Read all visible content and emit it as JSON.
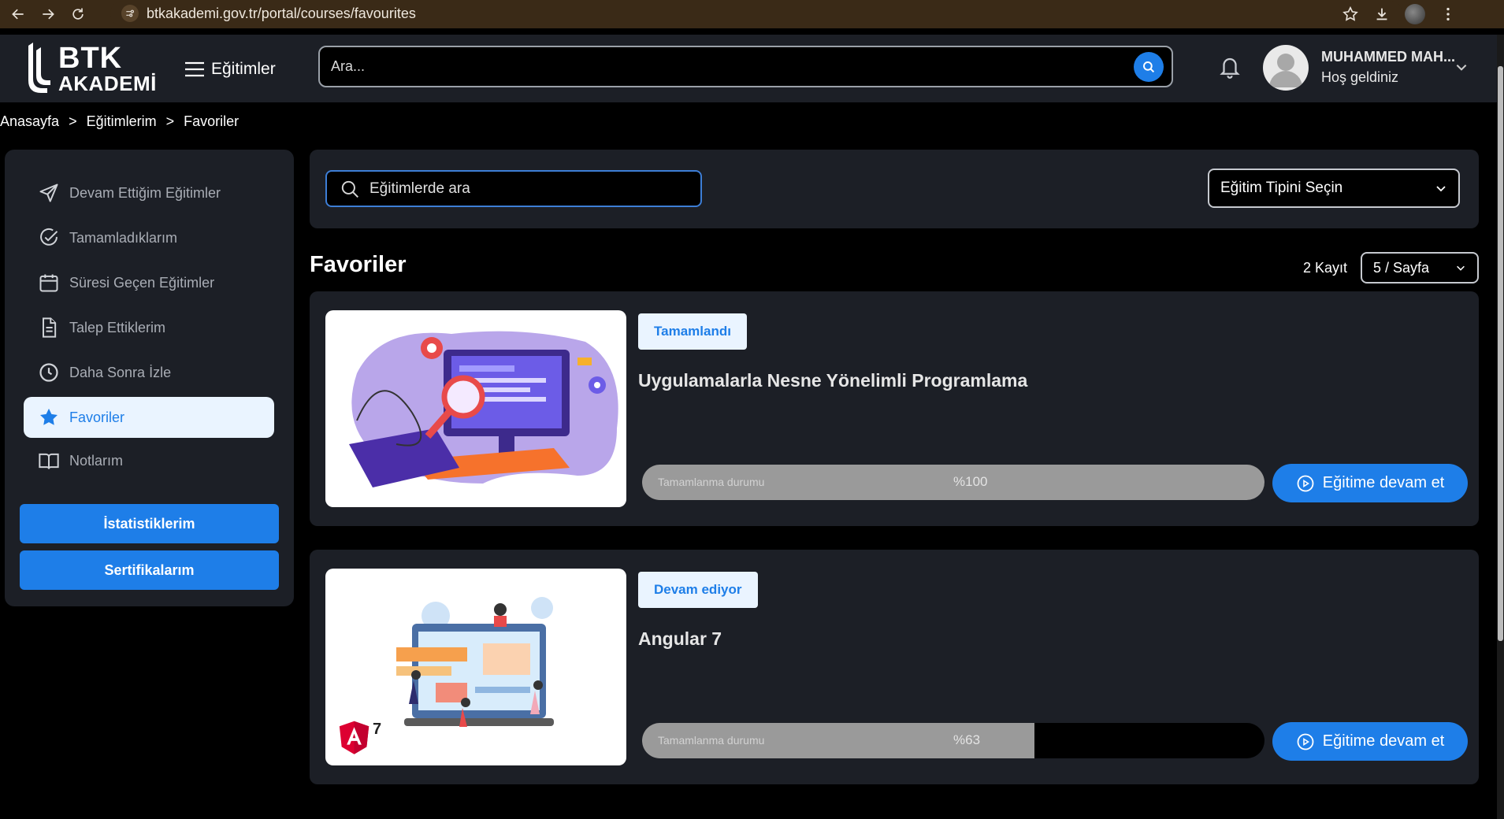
{
  "browser": {
    "url": "btkakademi.gov.tr/portal/courses/favourites"
  },
  "header": {
    "logo_line1": "BTK",
    "logo_line2": "AKADEMİ",
    "menu_label": "Eğitimler",
    "search_placeholder": "Ara...",
    "user_name": "MUHAMMED MAH...",
    "user_greeting": "Hoş geldiniz"
  },
  "breadcrumb": [
    "Anasayfa",
    ">",
    "Eğitimlerim",
    ">",
    "Favoriler"
  ],
  "sidebar": {
    "items": [
      {
        "label": "Devam Ettiğim Eğitimler",
        "icon": "send-icon"
      },
      {
        "label": "Tamamladıklarım",
        "icon": "check-circle-icon"
      },
      {
        "label": "Süresi Geçen Eğitimler",
        "icon": "calendar-icon"
      },
      {
        "label": "Talep Ettiklerim",
        "icon": "document-icon"
      },
      {
        "label": "Daha Sonra İzle",
        "icon": "clock-icon"
      },
      {
        "label": "Favoriler",
        "icon": "star-icon",
        "active": true
      },
      {
        "label": "Notlarım",
        "icon": "book-icon"
      }
    ],
    "buttons": [
      "İstatistiklerim",
      "Sertifikalarım"
    ]
  },
  "filters": {
    "search_placeholder": "Eğitimlerde ara",
    "type_select": "Eğitim Tipini Seçin"
  },
  "list": {
    "title": "Favoriler",
    "record_count": "2 Kayıt",
    "page_size": "5 / Sayfa"
  },
  "courses": [
    {
      "status": "Tamamlandı",
      "title": "Uygulamalarla Nesne Yönelimli Programlama",
      "progress_label": "Tamamlanma durumu",
      "progress_text": "%100",
      "progress": 1.0,
      "button": "Eğitime devam et"
    },
    {
      "status": "Devam ediyor",
      "title": "Angular 7",
      "progress_label": "Tamamlanma durumu",
      "progress_text": "%63",
      "progress": 0.63,
      "button": "Eğitime devam et",
      "logo_text": "7"
    }
  ],
  "colors": {
    "accent": "#1e7ee8",
    "panel": "#1c1f26",
    "badge_bg": "#eaf4ff"
  }
}
